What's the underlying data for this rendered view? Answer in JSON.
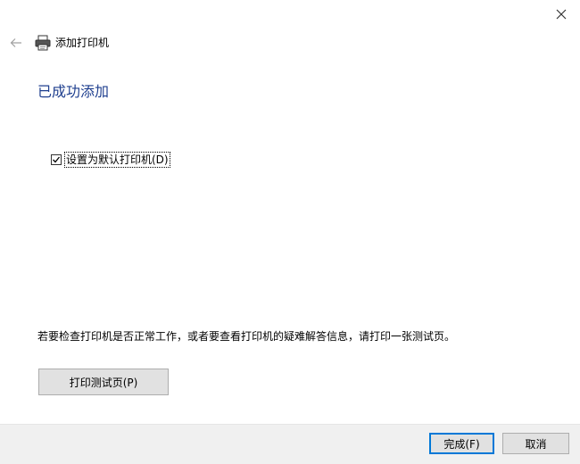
{
  "window": {
    "title": "添加打印机"
  },
  "main": {
    "heading": "已成功添加",
    "default_checkbox": {
      "label": "设置为默认打印机(D)",
      "checked": true
    },
    "info_text": "若要检查打印机是否正常工作，或者要查看打印机的疑难解答信息，请打印一张测试页。",
    "test_page_button": "打印测试页(P)"
  },
  "footer": {
    "finish_button": "完成(F)",
    "cancel_button": "取消"
  },
  "icons": {
    "close": "close-icon",
    "back": "back-arrow-icon",
    "printer": "printer-icon",
    "checkmark": "checkmark-icon"
  },
  "colors": {
    "heading": "#1f3f8f",
    "footer_bg": "#f0f0f0",
    "accent_border": "#0078d7",
    "button_bg": "#e1e1e1"
  }
}
